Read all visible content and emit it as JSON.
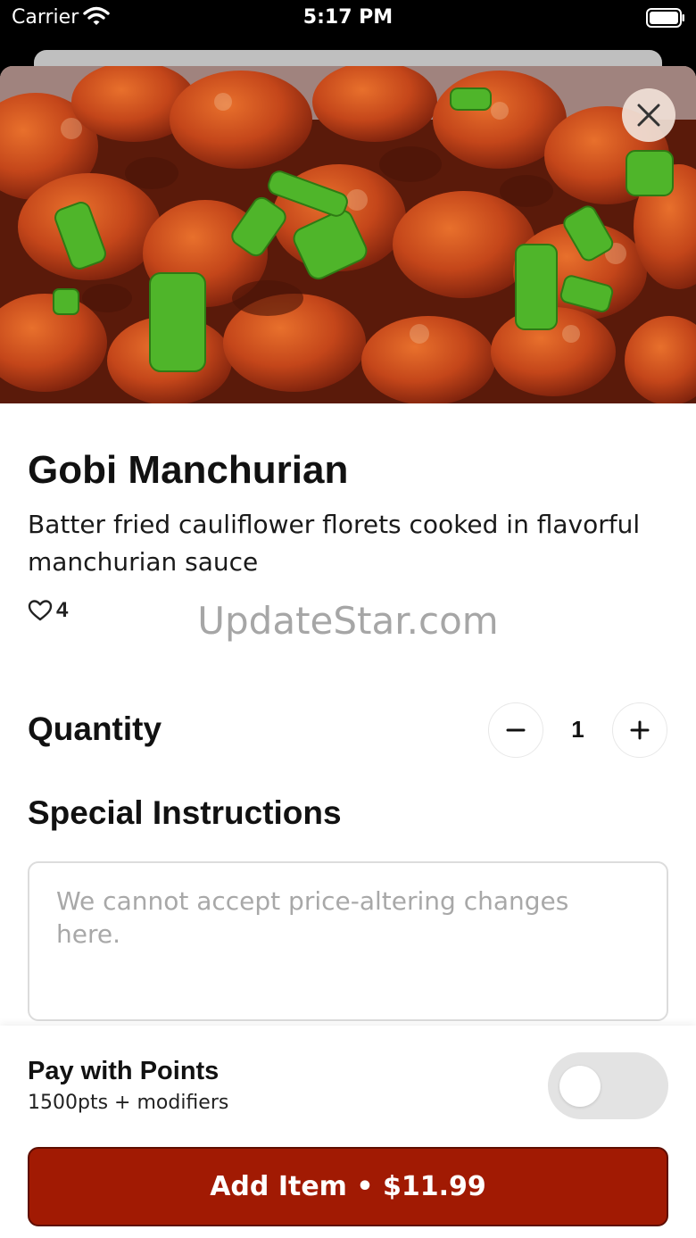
{
  "status_bar": {
    "carrier": "Carrier",
    "time": "5:17 PM"
  },
  "item": {
    "name": "Gobi Manchurian",
    "description": "Batter fried cauliflower florets cooked in flavorful manchurian sauce",
    "likes": "4"
  },
  "watermark": "UpdateStar.com",
  "quantity": {
    "label": "Quantity",
    "value": "1"
  },
  "instructions": {
    "label": "Special Instructions",
    "placeholder": "We cannot accept price-altering changes here."
  },
  "points": {
    "title": "Pay with Points",
    "subtitle": "1500pts + modifiers",
    "enabled": false
  },
  "add_button": {
    "label": "Add Item • $11.99"
  },
  "colors": {
    "accent": "#a11a03",
    "toggle_off": "#e3e3e3"
  },
  "icons": {
    "close": "close-icon",
    "like": "heart-outline-icon",
    "minus": "minus-icon",
    "plus": "plus-icon",
    "wifi": "wifi-icon",
    "battery": "battery-icon"
  }
}
